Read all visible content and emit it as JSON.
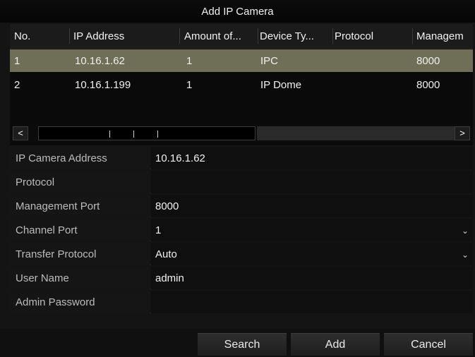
{
  "dialog": {
    "title": "Add IP Camera"
  },
  "table": {
    "columns": [
      "No.",
      "IP Address",
      "Amount of...",
      "Device Ty...",
      "Protocol",
      "Managem"
    ],
    "rows": [
      {
        "no": "1",
        "ip": "10.16.1.62",
        "amount": "1",
        "device_type": "IPC",
        "protocol": "",
        "port": "8000",
        "selected": true
      },
      {
        "no": "2",
        "ip": "10.16.1.199",
        "amount": "1",
        "device_type": "IP Dome",
        "protocol": "",
        "port": "8000",
        "selected": false
      }
    ],
    "scroll_left_glyph": "<",
    "scroll_right_glyph": ">"
  },
  "form": {
    "ip_camera_address": {
      "label": "IP Camera Address",
      "value": "10.16.1.62"
    },
    "protocol": {
      "label": "Protocol",
      "value": ""
    },
    "management_port": {
      "label": "Management Port",
      "value": "8000"
    },
    "channel_port": {
      "label": "Channel Port",
      "value": "1"
    },
    "transfer_protocol": {
      "label": "Transfer Protocol",
      "value": "Auto"
    },
    "user_name": {
      "label": "User Name",
      "value": "admin"
    },
    "admin_password": {
      "label": "Admin Password",
      "value": ""
    }
  },
  "buttons": {
    "search": "Search",
    "add": "Add",
    "cancel": "Cancel"
  },
  "colors": {
    "selected_row": "#6f6e56",
    "background": "#141414"
  }
}
